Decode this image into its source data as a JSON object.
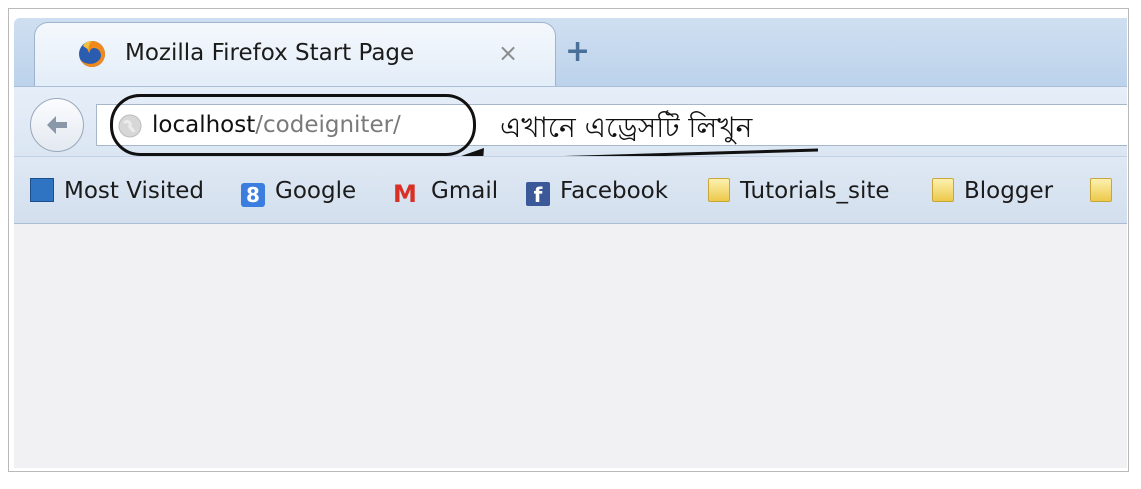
{
  "tab": {
    "title": "Mozilla Firefox Start Page",
    "close_glyph": "×",
    "new_tab_glyph": "+",
    "favicon": "firefox-icon"
  },
  "navigation": {
    "back_icon": "back-arrow-icon",
    "url_host": "localhost",
    "url_path": "/codeigniter/"
  },
  "annotation": {
    "text": "এখানে এড্রেসটি লিখুন"
  },
  "bookmarks": [
    {
      "label": "Most Visited",
      "icon": "most-visited-icon"
    },
    {
      "label": "Google",
      "icon": "google-icon",
      "glyph": "8"
    },
    {
      "label": "Gmail",
      "icon": "gmail-icon",
      "glyph": "M"
    },
    {
      "label": "Facebook",
      "icon": "facebook-icon",
      "glyph": "f"
    },
    {
      "label": "Tutorials_site",
      "icon": "folder-icon"
    },
    {
      "label": "Blogger",
      "icon": "folder-icon"
    }
  ],
  "colors": {
    "tab_strip": "#bcd2eb",
    "content_bg": "#f1f1f3",
    "facebook": "#3b5998",
    "gmail": "#d93025"
  }
}
